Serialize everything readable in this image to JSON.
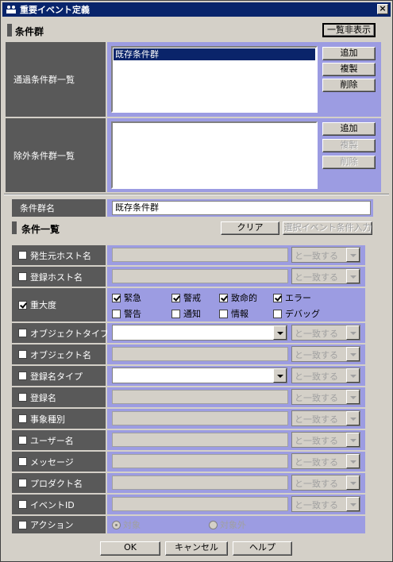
{
  "window": {
    "title": "重要イベント定義",
    "close": "×"
  },
  "section1": {
    "title": "条件群",
    "toggle_button": "一覧非表示"
  },
  "pass_group": {
    "label": "通過条件群一覧",
    "items": [
      "既存条件群"
    ],
    "add": "追加",
    "copy": "複製",
    "delete": "削除"
  },
  "exclude_group": {
    "label": "除外条件群一覧",
    "items": [],
    "add": "追加",
    "copy": "複製",
    "delete": "削除"
  },
  "group_name": {
    "label": "条件群名",
    "value": "既存条件群"
  },
  "section2": {
    "title": "条件一覧",
    "clear_button": "クリア",
    "select_event_button": "選択イベント条件入力"
  },
  "match_text": "と一致する",
  "conditions": {
    "source_host": "発生元ホスト名",
    "reg_host": "登録ホスト名",
    "severity": "重大度",
    "object_type": "オブジェクトタイプ",
    "object_name": "オブジェクト名",
    "reg_name_type": "登録名タイプ",
    "reg_name": "登録名",
    "event_kind": "事象種別",
    "user_name": "ユーザー名",
    "message": "メッセージ",
    "product_name": "プロダクト名",
    "event_id": "イベントID",
    "action": "アクション"
  },
  "severity_levels": {
    "emergency": "緊急",
    "alert": "警戒",
    "critical": "致命的",
    "error": "エラー",
    "warning": "警告",
    "notice": "通知",
    "info": "情報",
    "debug": "デバッグ"
  },
  "action_options": {
    "target": "対象",
    "non_target": "対象外"
  },
  "footer": {
    "ok": "OK",
    "cancel": "キャンセル",
    "help": "ヘルプ"
  }
}
